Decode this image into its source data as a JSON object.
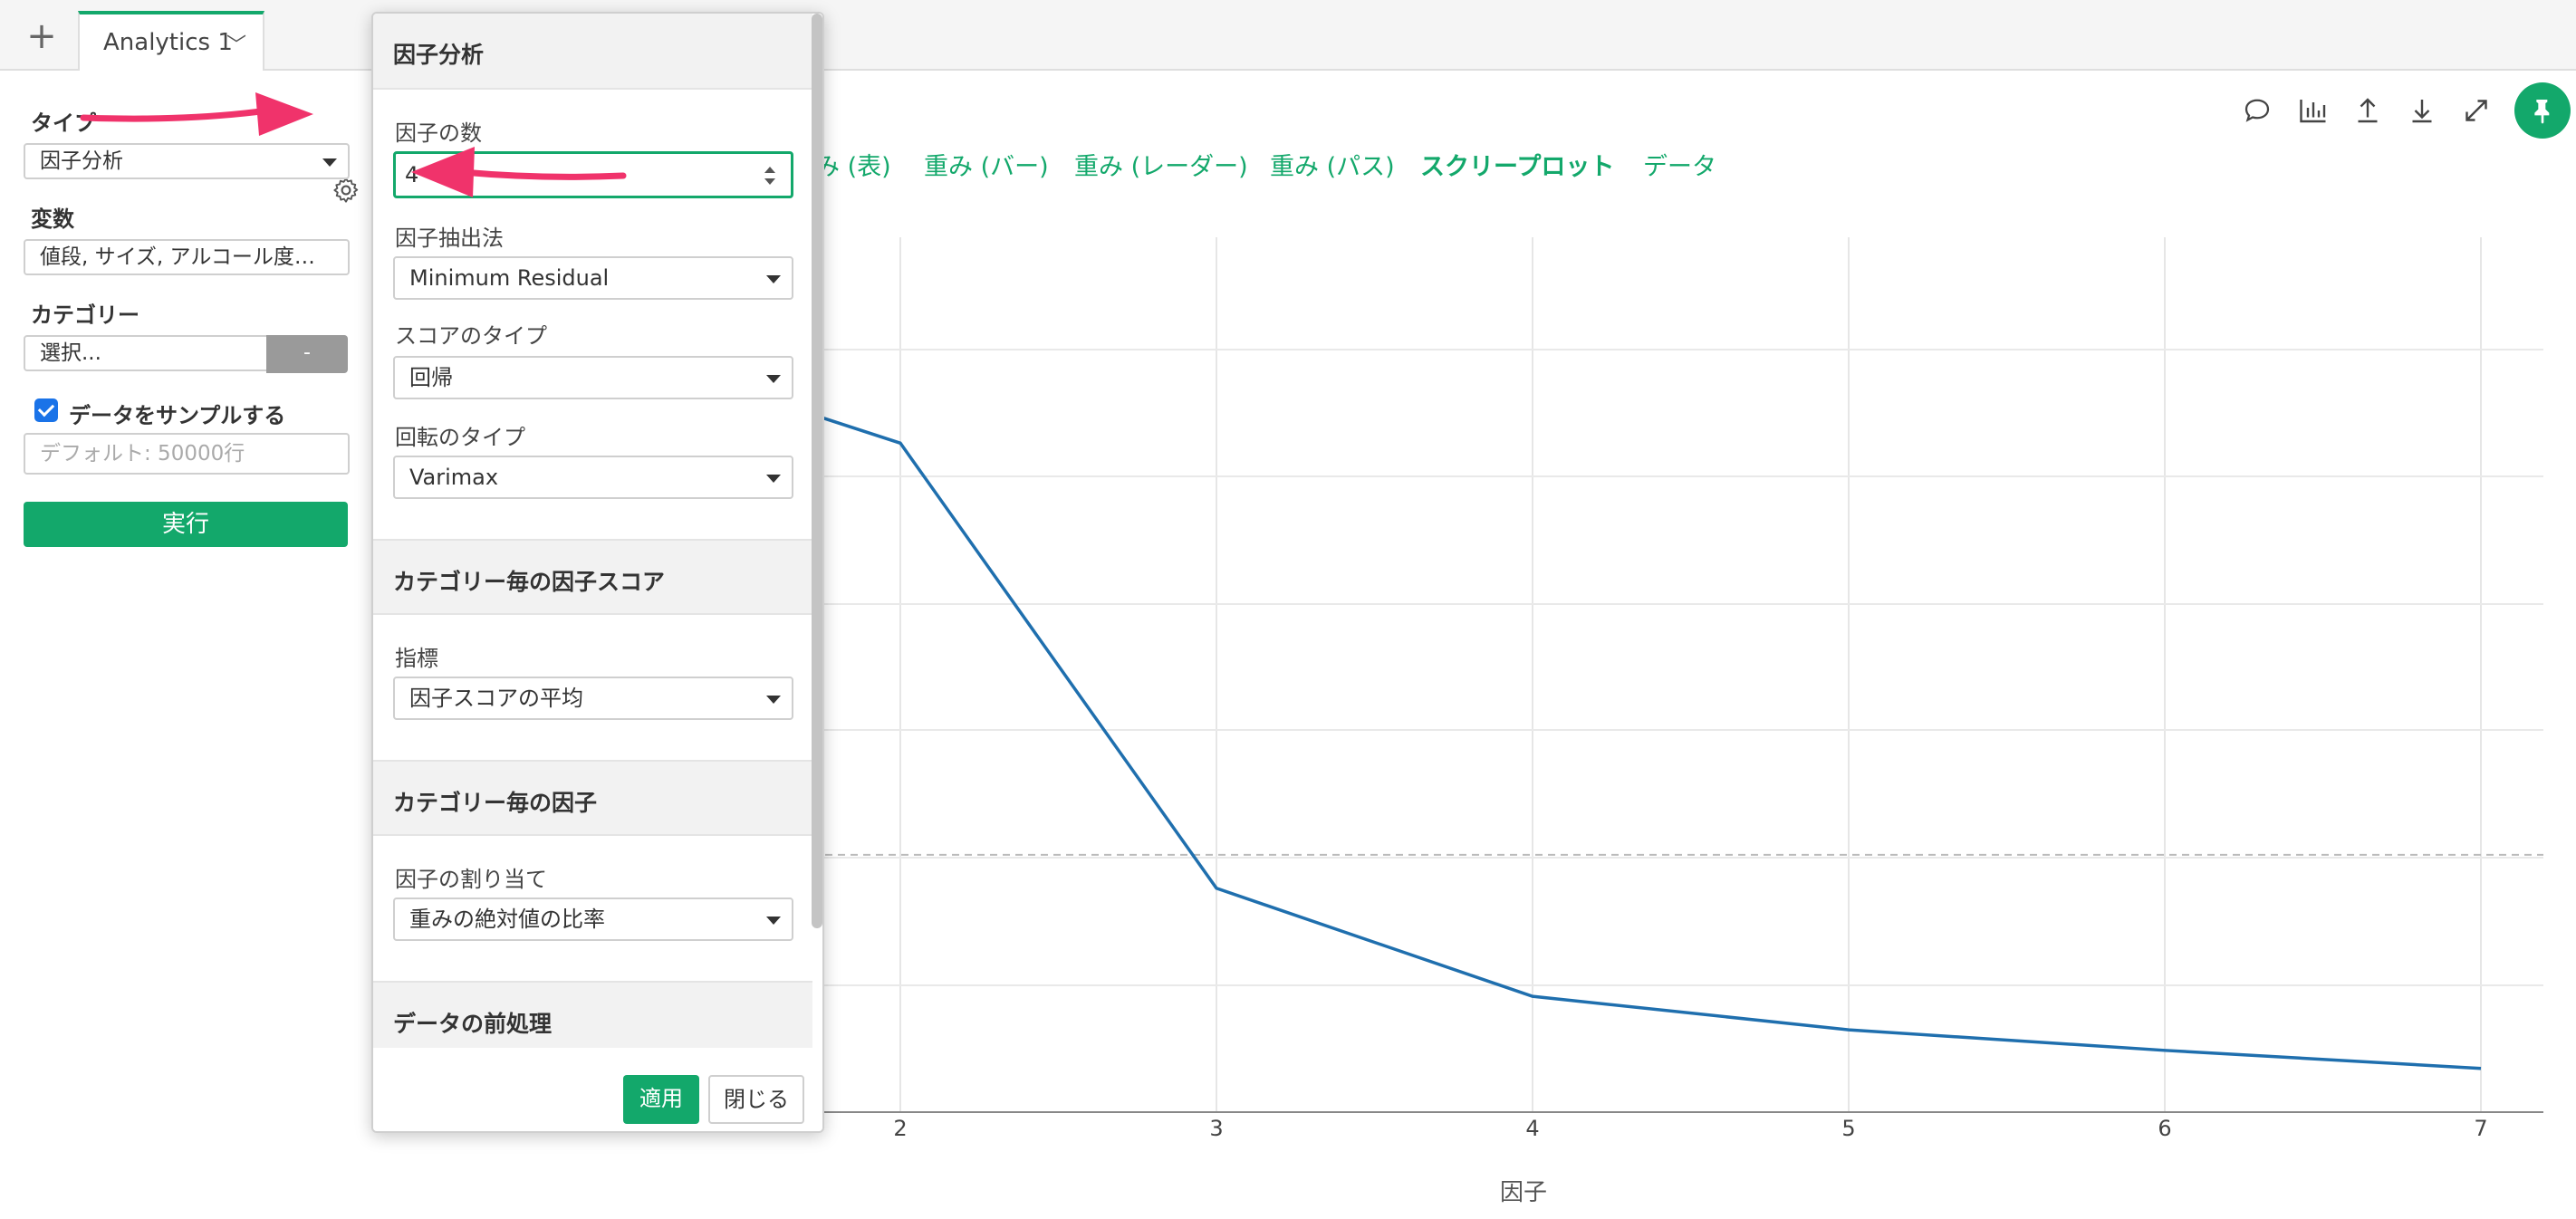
{
  "tabbar": {
    "add_icon": "plus-icon",
    "tab_label": "Analytics 1",
    "caret": "﹀"
  },
  "left": {
    "type_label": "タイプ",
    "type_value": "因子分析",
    "vars_label": "変数",
    "vars_value": "値段, サイズ, アルコール度…",
    "category_label": "カテゴリー",
    "category_placeholder": "選択...",
    "category_button": "-",
    "sample_label": "データをサンプルする",
    "sample_checked": true,
    "sample_placeholder": "デフォルト: 50000行",
    "run_label": "実行"
  },
  "header": {
    "icons": [
      "comment-icon",
      "chart-icon",
      "upload-icon",
      "download-icon",
      "expand-icon"
    ],
    "pin_icon": "pin-icon",
    "view_tabs": [
      {
        "label": "み (表)",
        "active": false
      },
      {
        "label": "重み (バー)",
        "active": false
      },
      {
        "label": "重み (レーダー)",
        "active": false
      },
      {
        "label": "重み (パス)",
        "active": false
      },
      {
        "label": "スクリープロット",
        "active": true
      },
      {
        "label": "データ",
        "active": false
      }
    ]
  },
  "chart_data": {
    "type": "line",
    "xlabel": "因子",
    "x": [
      1,
      2,
      3,
      4,
      5,
      6,
      7
    ],
    "x_tick_labels": [
      "2",
      "3",
      "4",
      "5",
      "6",
      "7"
    ],
    "series": [
      {
        "values": [
          3.0,
          2.6,
          0.87,
          0.45,
          0.32,
          0.24,
          0.17
        ]
      }
    ],
    "reference_line": 1.0,
    "ylim": [
      0,
      3.4
    ],
    "grid": true,
    "line_color": "#1f6fae"
  },
  "dialog": {
    "title": "因子分析",
    "num_factors_label": "因子の数",
    "num_factors_value": "4",
    "extraction_label": "因子抽出法",
    "extraction_value": "Minimum Residual",
    "score_type_label": "スコアのタイプ",
    "score_type_value": "回帰",
    "rotation_label": "回転のタイプ",
    "rotation_value": "Varimax",
    "cat_score_heading": "カテゴリー毎の因子スコア",
    "metric_label": "指標",
    "metric_value": "因子スコアの平均",
    "cat_factor_heading": "カテゴリー毎の因子",
    "assign_label": "因子の割り当て",
    "assign_value": "重みの絶対値の比率",
    "preprocess_heading": "データの前処理",
    "apply_label": "適用",
    "close_label": "閉じる"
  },
  "annotations": {
    "arrow_color": "#f0336b"
  }
}
